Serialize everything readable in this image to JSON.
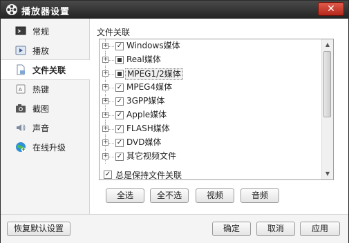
{
  "window": {
    "title": "播放器设置"
  },
  "sidebar": {
    "items": [
      {
        "label": "常规",
        "icon": "monitor-icon"
      },
      {
        "label": "播放",
        "icon": "play-icon"
      },
      {
        "label": "文件关联",
        "icon": "document-icon",
        "active": true
      },
      {
        "label": "热键",
        "icon": "keyboard-key-icon"
      },
      {
        "label": "截图",
        "icon": "camera-icon"
      },
      {
        "label": "声音",
        "icon": "speaker-icon"
      },
      {
        "label": "在线升级",
        "icon": "globe-update-icon"
      }
    ]
  },
  "file_assoc": {
    "section_title": "文件关联",
    "tree": [
      {
        "label": "Windows媒体",
        "state": "checked"
      },
      {
        "label": "Real媒体",
        "state": "partial"
      },
      {
        "label": "MPEG1/2媒体",
        "state": "partial",
        "selected": true
      },
      {
        "label": "MPEG4媒体",
        "state": "checked"
      },
      {
        "label": "3GPP媒体",
        "state": "checked"
      },
      {
        "label": "Apple媒体",
        "state": "checked"
      },
      {
        "label": "FLASH媒体",
        "state": "checked"
      },
      {
        "label": "DVD媒体",
        "state": "checked"
      },
      {
        "label": "其它视频文件",
        "state": "checked"
      }
    ],
    "keep_label": "总是保持文件关联",
    "keep_checked": true,
    "buttons": {
      "select_all": "全选",
      "select_none": "全不选",
      "video": "视频",
      "audio": "音频"
    }
  },
  "footer": {
    "restore_defaults": "恢复默认设置",
    "ok": "确定",
    "cancel": "取消",
    "apply": "应用"
  }
}
